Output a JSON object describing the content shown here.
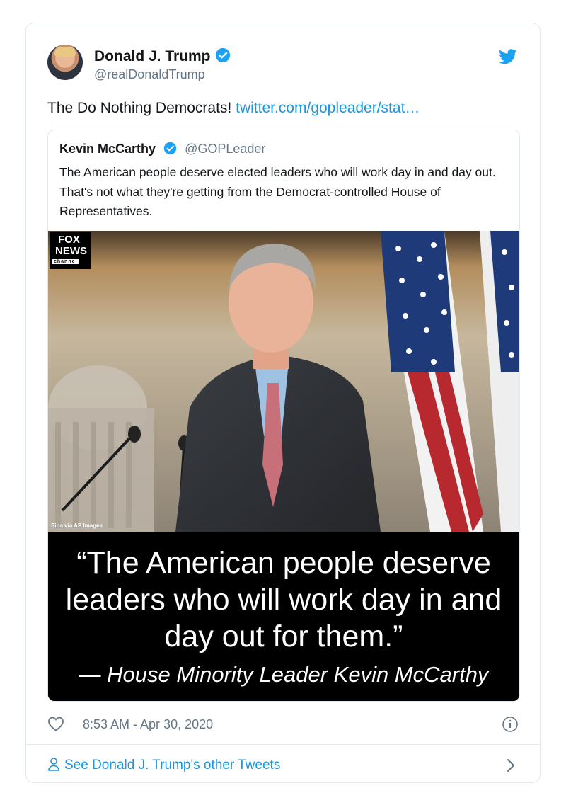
{
  "author": {
    "name": "Donald J. Trump",
    "handle": "@realDonaldTrump"
  },
  "tweet": {
    "text": "The Do Nothing Democrats!",
    "link": "twitter.com/gopleader/stat…"
  },
  "quoted_tweet": {
    "name": "Kevin McCarthy",
    "handle": "@GOPLeader",
    "text": "The American people deserve elected leaders who will work day in and day out. That's not what they're getting from the Democrat-controlled House of Representatives."
  },
  "media": {
    "logo_line1": "FOX",
    "logo_line2": "NEWS",
    "logo_line3": "channel",
    "credit": "Sipa via AP Images",
    "quote_line1": "“The American people deserve",
    "quote_line2": "leaders who will work day in and",
    "quote_line3": "day out for them.”",
    "attribution": "— House Minority Leader Kevin McCarthy"
  },
  "meta": {
    "timestamp": "8:53 AM - Apr 30, 2020"
  },
  "footer": {
    "label": "See Donald J. Trump's other Tweets"
  },
  "colors": {
    "link": "#1b95e0",
    "secondary_text": "#657786",
    "border": "#e1e8ed"
  },
  "icons": [
    "verified-icon",
    "twitter-bird-icon",
    "heart-icon",
    "info-icon",
    "person-icon",
    "chevron-right-icon"
  ]
}
